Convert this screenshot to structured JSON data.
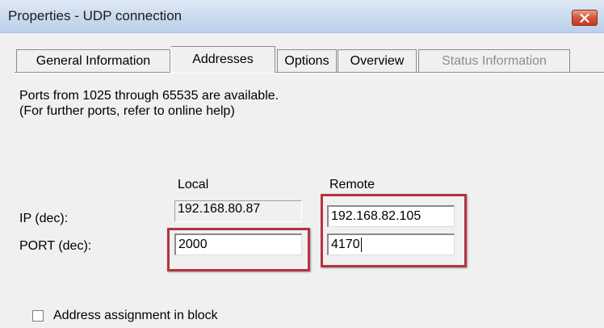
{
  "window": {
    "title": "Properties - UDP connection"
  },
  "tabs": [
    {
      "label": "General Information",
      "active": false,
      "enabled": true
    },
    {
      "label": "Addresses",
      "active": true,
      "enabled": true
    },
    {
      "label": "Options",
      "active": false,
      "enabled": true
    },
    {
      "label": "Overview",
      "active": false,
      "enabled": true
    },
    {
      "label": "Status Information",
      "active": false,
      "enabled": false
    }
  ],
  "info": {
    "line1": "Ports from 1025 through 65535 are available.",
    "line2": "(For further ports, refer to online help)"
  },
  "columns": {
    "local": "Local",
    "remote": "Remote"
  },
  "rows": {
    "ip_label": "IP (dec):",
    "port_label": "PORT (dec):"
  },
  "fields": {
    "local_ip": "192.168.80.87",
    "local_port": "2000",
    "remote_ip": "192.168.82.105",
    "remote_port": "4170"
  },
  "checkbox": {
    "label": "Address assignment in block",
    "checked": false
  },
  "colors": {
    "highlight": "#b4343f",
    "close_button": "#c53a22"
  }
}
